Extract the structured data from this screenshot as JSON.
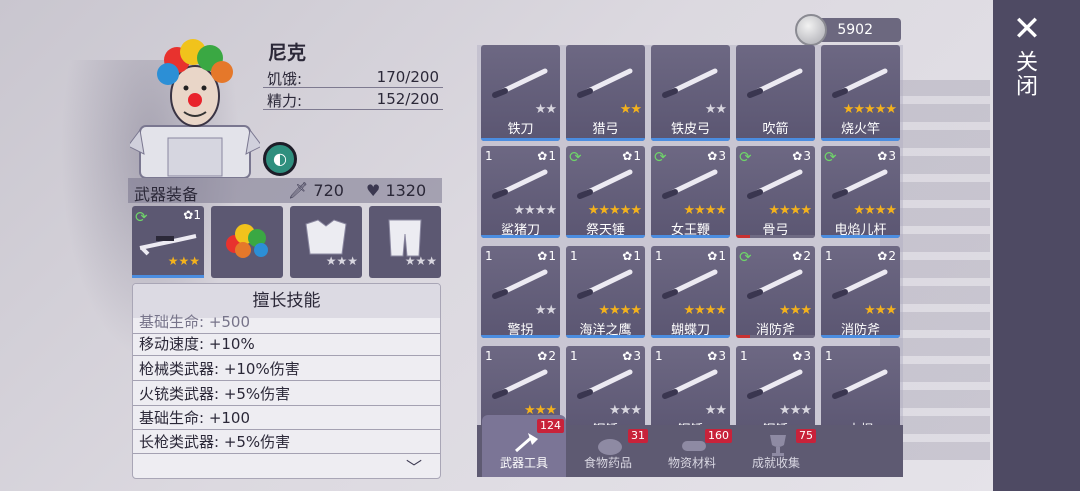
{
  "currency": {
    "amount": "5902"
  },
  "close": {
    "icon": "close-icon",
    "label": "关闭"
  },
  "character": {
    "name": "尼克",
    "hunger_label": "饥饿:",
    "hunger_value": "170/200",
    "energy_label": "精力:",
    "energy_value": "152/200"
  },
  "weapon_equip": {
    "title": "武器装备",
    "attack": "720",
    "health": "1320"
  },
  "equip_slots": [
    {
      "name": "sniper-rifle",
      "stars": 3,
      "level": "1",
      "refresh": true
    },
    {
      "name": "rainbow-wig",
      "stars": 0
    },
    {
      "name": "armor-vest",
      "stars": 2
    },
    {
      "name": "armor-pants",
      "stars": 2
    }
  ],
  "skills": {
    "title": "擅长技能",
    "rows": [
      "基础生命: +500",
      "移动速度: +10%",
      "枪械类武器: +10%伤害",
      "火铳类武器: +5%伤害",
      "基础生命: +100",
      "长枪类武器: +5%伤害"
    ]
  },
  "items": [
    {
      "name": "铁刀",
      "gold": 0,
      "white": 2,
      "count": "",
      "level": "",
      "refresh": false,
      "bar": "blue"
    },
    {
      "name": "猎弓",
      "gold": 2,
      "white": 0,
      "count": "",
      "level": "",
      "refresh": false,
      "bar": "blue"
    },
    {
      "name": "铁皮弓",
      "gold": 0,
      "white": 2,
      "count": "",
      "level": "",
      "refresh": false,
      "bar": "blue"
    },
    {
      "name": "吹箭",
      "gold": 0,
      "white": 0,
      "count": "",
      "level": "",
      "refresh": false,
      "bar": "blue"
    },
    {
      "name": "烧火竿",
      "gold": 5,
      "white": 0,
      "count": "",
      "level": "",
      "refresh": false,
      "bar": "blue"
    },
    {
      "name": "鲨猪刀",
      "gold": 0,
      "white": 4,
      "count": "1",
      "level": "1",
      "refresh": false,
      "bar": "blue"
    },
    {
      "name": "祭天锤",
      "gold": 5,
      "white": 0,
      "count": "",
      "level": "1",
      "refresh": true,
      "bar": "blue"
    },
    {
      "name": "女王鞭",
      "gold": 4,
      "white": 0,
      "count": "",
      "level": "3",
      "refresh": true,
      "bar": "blue"
    },
    {
      "name": "骨弓",
      "gold": 4,
      "white": 0,
      "count": "",
      "level": "3",
      "refresh": true,
      "bar": "red"
    },
    {
      "name": "电焰儿杆",
      "gold": 4,
      "white": 0,
      "count": "",
      "level": "3",
      "refresh": true,
      "bar": "blue"
    },
    {
      "name": "警拐",
      "gold": 0,
      "white": 2,
      "count": "1",
      "level": "1",
      "refresh": false,
      "bar": "blue"
    },
    {
      "name": "海洋之鹰",
      "gold": 4,
      "white": 0,
      "count": "1",
      "level": "1",
      "refresh": false,
      "bar": "blue"
    },
    {
      "name": "蝴蝶刀",
      "gold": 4,
      "white": 0,
      "count": "1",
      "level": "1",
      "refresh": false,
      "bar": "blue"
    },
    {
      "name": "消防斧",
      "gold": 3,
      "white": 0,
      "count": "",
      "level": "2",
      "refresh": true,
      "bar": "red"
    },
    {
      "name": "消防斧",
      "gold": 3,
      "white": 0,
      "count": "1",
      "level": "2",
      "refresh": false,
      "bar": "blue"
    },
    {
      "name": "狼牙棒",
      "gold": 3,
      "white": 0,
      "count": "1",
      "level": "2",
      "refresh": false,
      "bar": "none"
    },
    {
      "name": "钢锤",
      "gold": 0,
      "white": 3,
      "count": "1",
      "level": "3",
      "refresh": false,
      "bar": "none"
    },
    {
      "name": "钢锤",
      "gold": 0,
      "white": 2,
      "count": "1",
      "level": "3",
      "refresh": false,
      "bar": "none"
    },
    {
      "name": "钢锤",
      "gold": 0,
      "white": 3,
      "count": "1",
      "level": "3",
      "refresh": false,
      "bar": "none"
    },
    {
      "name": "木棍",
      "gold": 0,
      "white": 0,
      "count": "1",
      "level": "",
      "refresh": false,
      "bar": "none"
    }
  ],
  "tabs": [
    {
      "label": "武器工具",
      "badge": "124",
      "active": true
    },
    {
      "label": "食物药品",
      "badge": "31",
      "active": false
    },
    {
      "label": "物资材料",
      "badge": "160",
      "active": false
    },
    {
      "label": "成就收集",
      "badge": "75",
      "active": false
    }
  ]
}
